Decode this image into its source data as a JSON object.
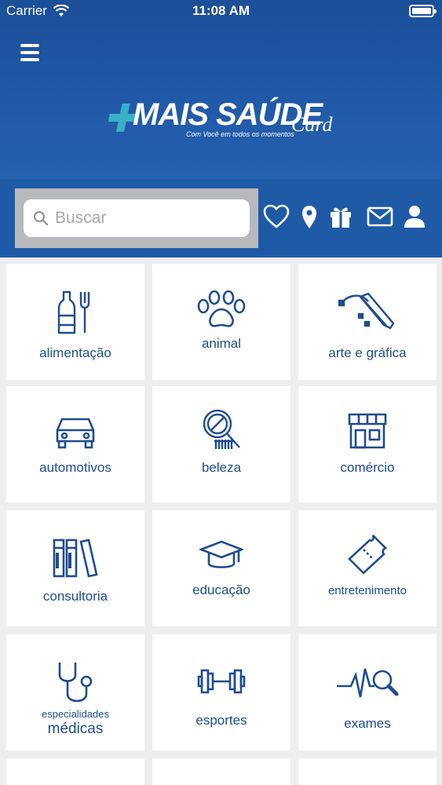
{
  "status_bar": {
    "carrier": "Carrier",
    "time": "11:08 AM"
  },
  "header": {
    "logo_text": "MAIS SAÚDE",
    "logo_card": "Card",
    "logo_tagline": "Com Você em todos os momentos"
  },
  "search": {
    "placeholder": "Buscar"
  },
  "categories": [
    {
      "label": "alimentação",
      "icon": "food-drink-icon"
    },
    {
      "label": "animal",
      "icon": "paw-icon"
    },
    {
      "label": "arte e gráfica",
      "icon": "pen-tool-icon"
    },
    {
      "label": "automotivos",
      "icon": "car-icon"
    },
    {
      "label": "beleza",
      "icon": "mirror-brush-icon"
    },
    {
      "label": "comércio",
      "icon": "store-icon"
    },
    {
      "label": "consultoria",
      "icon": "binders-icon"
    },
    {
      "label": "educação",
      "icon": "graduation-cap-icon"
    },
    {
      "label": "entretenimento",
      "icon": "ticket-icon"
    },
    {
      "label": "especialidades",
      "label2": "médicas",
      "icon": "stethoscope-icon"
    },
    {
      "label": "esportes",
      "icon": "dumbbell-icon"
    },
    {
      "label": "exames",
      "icon": "heartbeat-magnifier-icon"
    }
  ],
  "colors": {
    "header": "#215aa8",
    "toolbar": "#1f5aa6",
    "icon": "#1f4c8d",
    "tile": "#ffffff"
  }
}
